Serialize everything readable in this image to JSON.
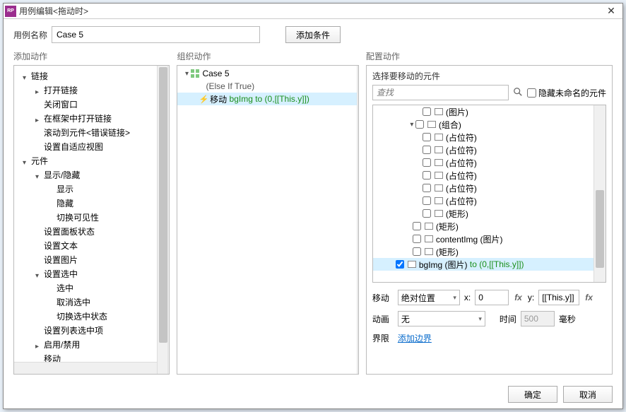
{
  "titlebar": {
    "title": "用例编辑<拖动时>"
  },
  "top": {
    "nameLabel": "用例名称",
    "caseName": "Case 5",
    "addCondition": "添加条件"
  },
  "panelTitles": {
    "add": "添加动作",
    "org": "组织动作",
    "cfg": "配置动作"
  },
  "addTree": [
    {
      "label": "链接",
      "expand": "down",
      "indent": 0
    },
    {
      "label": "打开链接",
      "expand": "right",
      "indent": 1
    },
    {
      "label": "关闭窗口",
      "expand": "none",
      "indent": 1
    },
    {
      "label": "在框架中打开链接",
      "expand": "right",
      "indent": 1
    },
    {
      "label": "滚动到元件<错误链接>",
      "expand": "none",
      "indent": 1
    },
    {
      "label": "设置自适应视图",
      "expand": "none",
      "indent": 1
    },
    {
      "label": "元件",
      "expand": "down",
      "indent": 0
    },
    {
      "label": "显示/隐藏",
      "expand": "down",
      "indent": 1
    },
    {
      "label": "显示",
      "expand": "none",
      "indent": 2
    },
    {
      "label": "隐藏",
      "expand": "none",
      "indent": 2
    },
    {
      "label": "切换可见性",
      "expand": "none",
      "indent": 2
    },
    {
      "label": "设置面板状态",
      "expand": "none",
      "indent": 1
    },
    {
      "label": "设置文本",
      "expand": "none",
      "indent": 1
    },
    {
      "label": "设置图片",
      "expand": "none",
      "indent": 1
    },
    {
      "label": "设置选中",
      "expand": "down",
      "indent": 1
    },
    {
      "label": "选中",
      "expand": "none",
      "indent": 2
    },
    {
      "label": "取消选中",
      "expand": "none",
      "indent": 2
    },
    {
      "label": "切换选中状态",
      "expand": "none",
      "indent": 2
    },
    {
      "label": "设置列表选中项",
      "expand": "none",
      "indent": 1
    },
    {
      "label": "启用/禁用",
      "expand": "right",
      "indent": 1
    },
    {
      "label": "移动",
      "expand": "none",
      "indent": 1
    }
  ],
  "orgTree": {
    "caseLabel": "Case 5",
    "caseLine2": "(Else If True)",
    "actionPrefix": "移动",
    "actionTarget": "bgImg to (0,[[This.y]])"
  },
  "cfg": {
    "subTitle": "选择要移动的元件",
    "searchPlaceholder": "查找",
    "hideUnnamed": "隐藏未命名的元件",
    "widgets": [
      {
        "indent": 70,
        "check": false,
        "tri": "",
        "label": "(图片)"
      },
      {
        "indent": 50,
        "check": false,
        "tri": "down",
        "label": "(组合)"
      },
      {
        "indent": 70,
        "check": false,
        "tri": "",
        "label": "(占位符)"
      },
      {
        "indent": 70,
        "check": false,
        "tri": "",
        "label": "(占位符)"
      },
      {
        "indent": 70,
        "check": false,
        "tri": "",
        "label": "(占位符)"
      },
      {
        "indent": 70,
        "check": false,
        "tri": "",
        "label": "(占位符)"
      },
      {
        "indent": 70,
        "check": false,
        "tri": "",
        "label": "(占位符)"
      },
      {
        "indent": 70,
        "check": false,
        "tri": "",
        "label": "(占位符)"
      },
      {
        "indent": 70,
        "check": false,
        "tri": "",
        "label": "(矩形)"
      },
      {
        "indent": 56,
        "check": false,
        "tri": "",
        "label": "(矩形)"
      },
      {
        "indent": 56,
        "check": false,
        "tri": "",
        "label": "contentImg (图片)"
      },
      {
        "indent": 56,
        "check": false,
        "tri": "",
        "label": "(矩形)"
      },
      {
        "indent": 32,
        "check": true,
        "tri": "",
        "label": "bgImg (图片)",
        "suffix": "to (0,[[This.y]])",
        "sel": true
      }
    ],
    "moveLabel": "移动",
    "moveSelect": "绝对位置",
    "xLabel": "x:",
    "xValue": "0",
    "yLabel": "y:",
    "yValue": "[[This.y]]",
    "animLabel": "动画",
    "animSelect": "无",
    "timeLabel": "时间",
    "timeValue": "500",
    "timeUnit": "毫秒",
    "boundLabel": "界限",
    "addBound": "添加边界"
  },
  "footer": {
    "ok": "确定",
    "cancel": "取消"
  }
}
